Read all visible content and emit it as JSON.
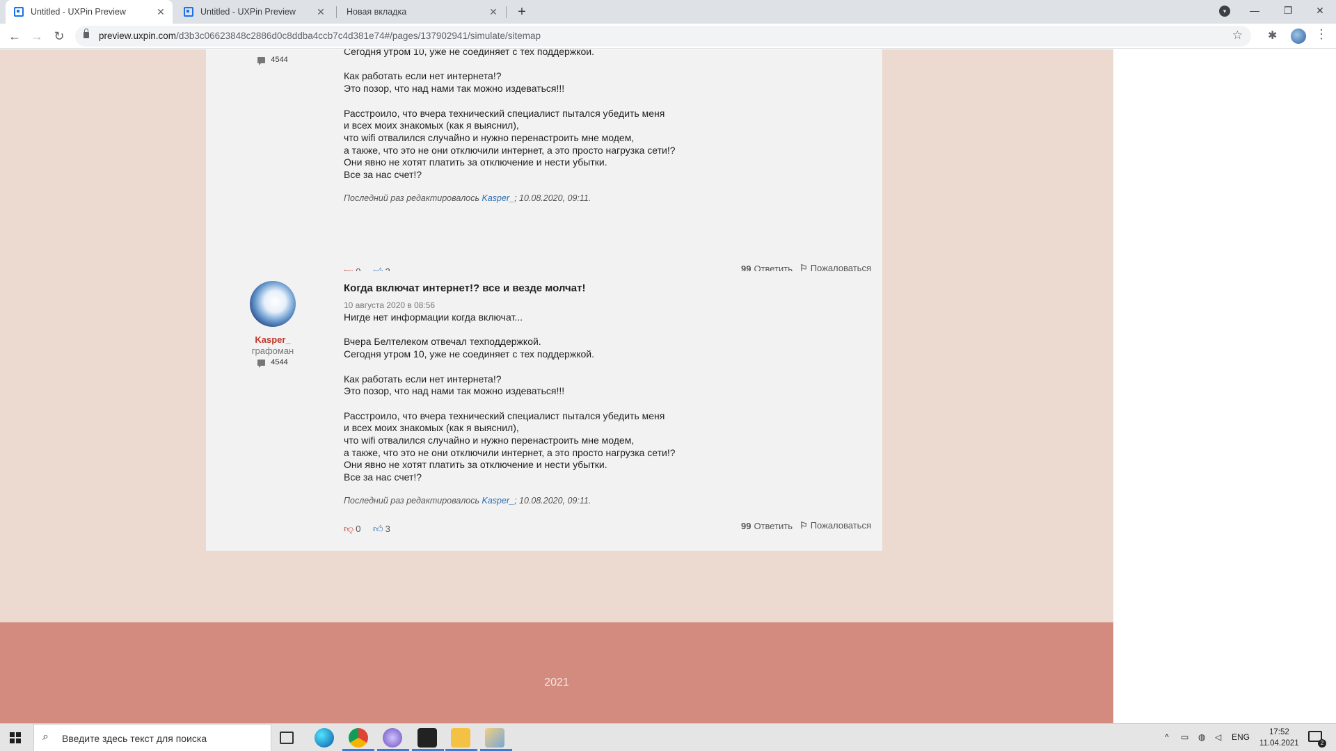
{
  "browser": {
    "tabs": [
      {
        "title": "Untitled - UXPin Preview"
      },
      {
        "title": "Untitled - UXPin Preview"
      },
      {
        "title": "Новая вкладка"
      }
    ],
    "url_host": "preview.uxpin.com",
    "url_rest": "/d3b3c06623848c2886d0c8ddba4ccb7c4d381e74#/pages/137902941/simulate/sitemap"
  },
  "posts": [
    {
      "author": {
        "count": "4544"
      },
      "body_partial_top": "Сегодня утром 10, уже не соединяет с тех поддержкой.",
      "body": "Как работать если нет интернета!?\nЭто позор, что над нами так можно издеваться!!!\n\nРасстроило, что вчера технический специалист пытался убедить меня\nи всех моих знакомых (как я выяснил),\nчто wifi отвалился случайно и нужно перенастроить мне модем,\nа также, что это не они отключили интернет, а это просто нагрузка сети!?\nОни явно не хотят платить за отключение и нести убытки.\nВсе за нас счет!?",
      "edited_prefix": "Последний раз редактировалось",
      "edited_by": "Kasper_",
      "edited_at": "; 10.08.2020, 09:11.",
      "dislikes": "0",
      "likes": "3",
      "reply_label": "Ответить",
      "report_label": "Пожаловаться"
    },
    {
      "author": {
        "name": "Kasper_",
        "rank": "графоман",
        "count": "4544"
      },
      "title": "Когда включат интернет!? все и везде молчат!",
      "date": "10 августа 2020 в 08:56",
      "body": "Нигде нет информации когда включат...\n\nВчера Белтелеком отвечал техподдержкой.\nСегодня утром 10, уже не соединяет с тех поддержкой.\n\nКак работать если нет интернета!?\nЭто позор, что над нами так можно издеваться!!!\n\nРасстроило, что вчера технический специалист пытался убедить меня\nи всех моих знакомых (как я выяснил),\nчто wifi отвалился случайно и нужно перенастроить мне модем,\nа также, что это не они отключили интернет, а это просто нагрузка сети!?\nОни явно не хотят платить за отключение и нести убытки.\nВсе за нас счет!?",
      "edited_prefix": "Последний раз редактировалось",
      "edited_by": "Kasper_",
      "edited_at": "; 10.08.2020, 09:11.",
      "dislikes": "0",
      "likes": "3",
      "reply_label": "Ответить",
      "report_label": "Пожаловаться"
    }
  ],
  "footer": {
    "year": "2021"
  },
  "taskbar": {
    "search_placeholder": "Введите здесь текст для поиска",
    "lang": "ENG",
    "time": "17:52",
    "date": "11.04.2021",
    "notif_count": "2"
  },
  "colors": {
    "page_bg": "#ecd9cf",
    "card_bg": "#f2f2f2",
    "footer_bg": "#d38b7f",
    "author_name": "#c0392b",
    "link": "#2a6fb0"
  }
}
